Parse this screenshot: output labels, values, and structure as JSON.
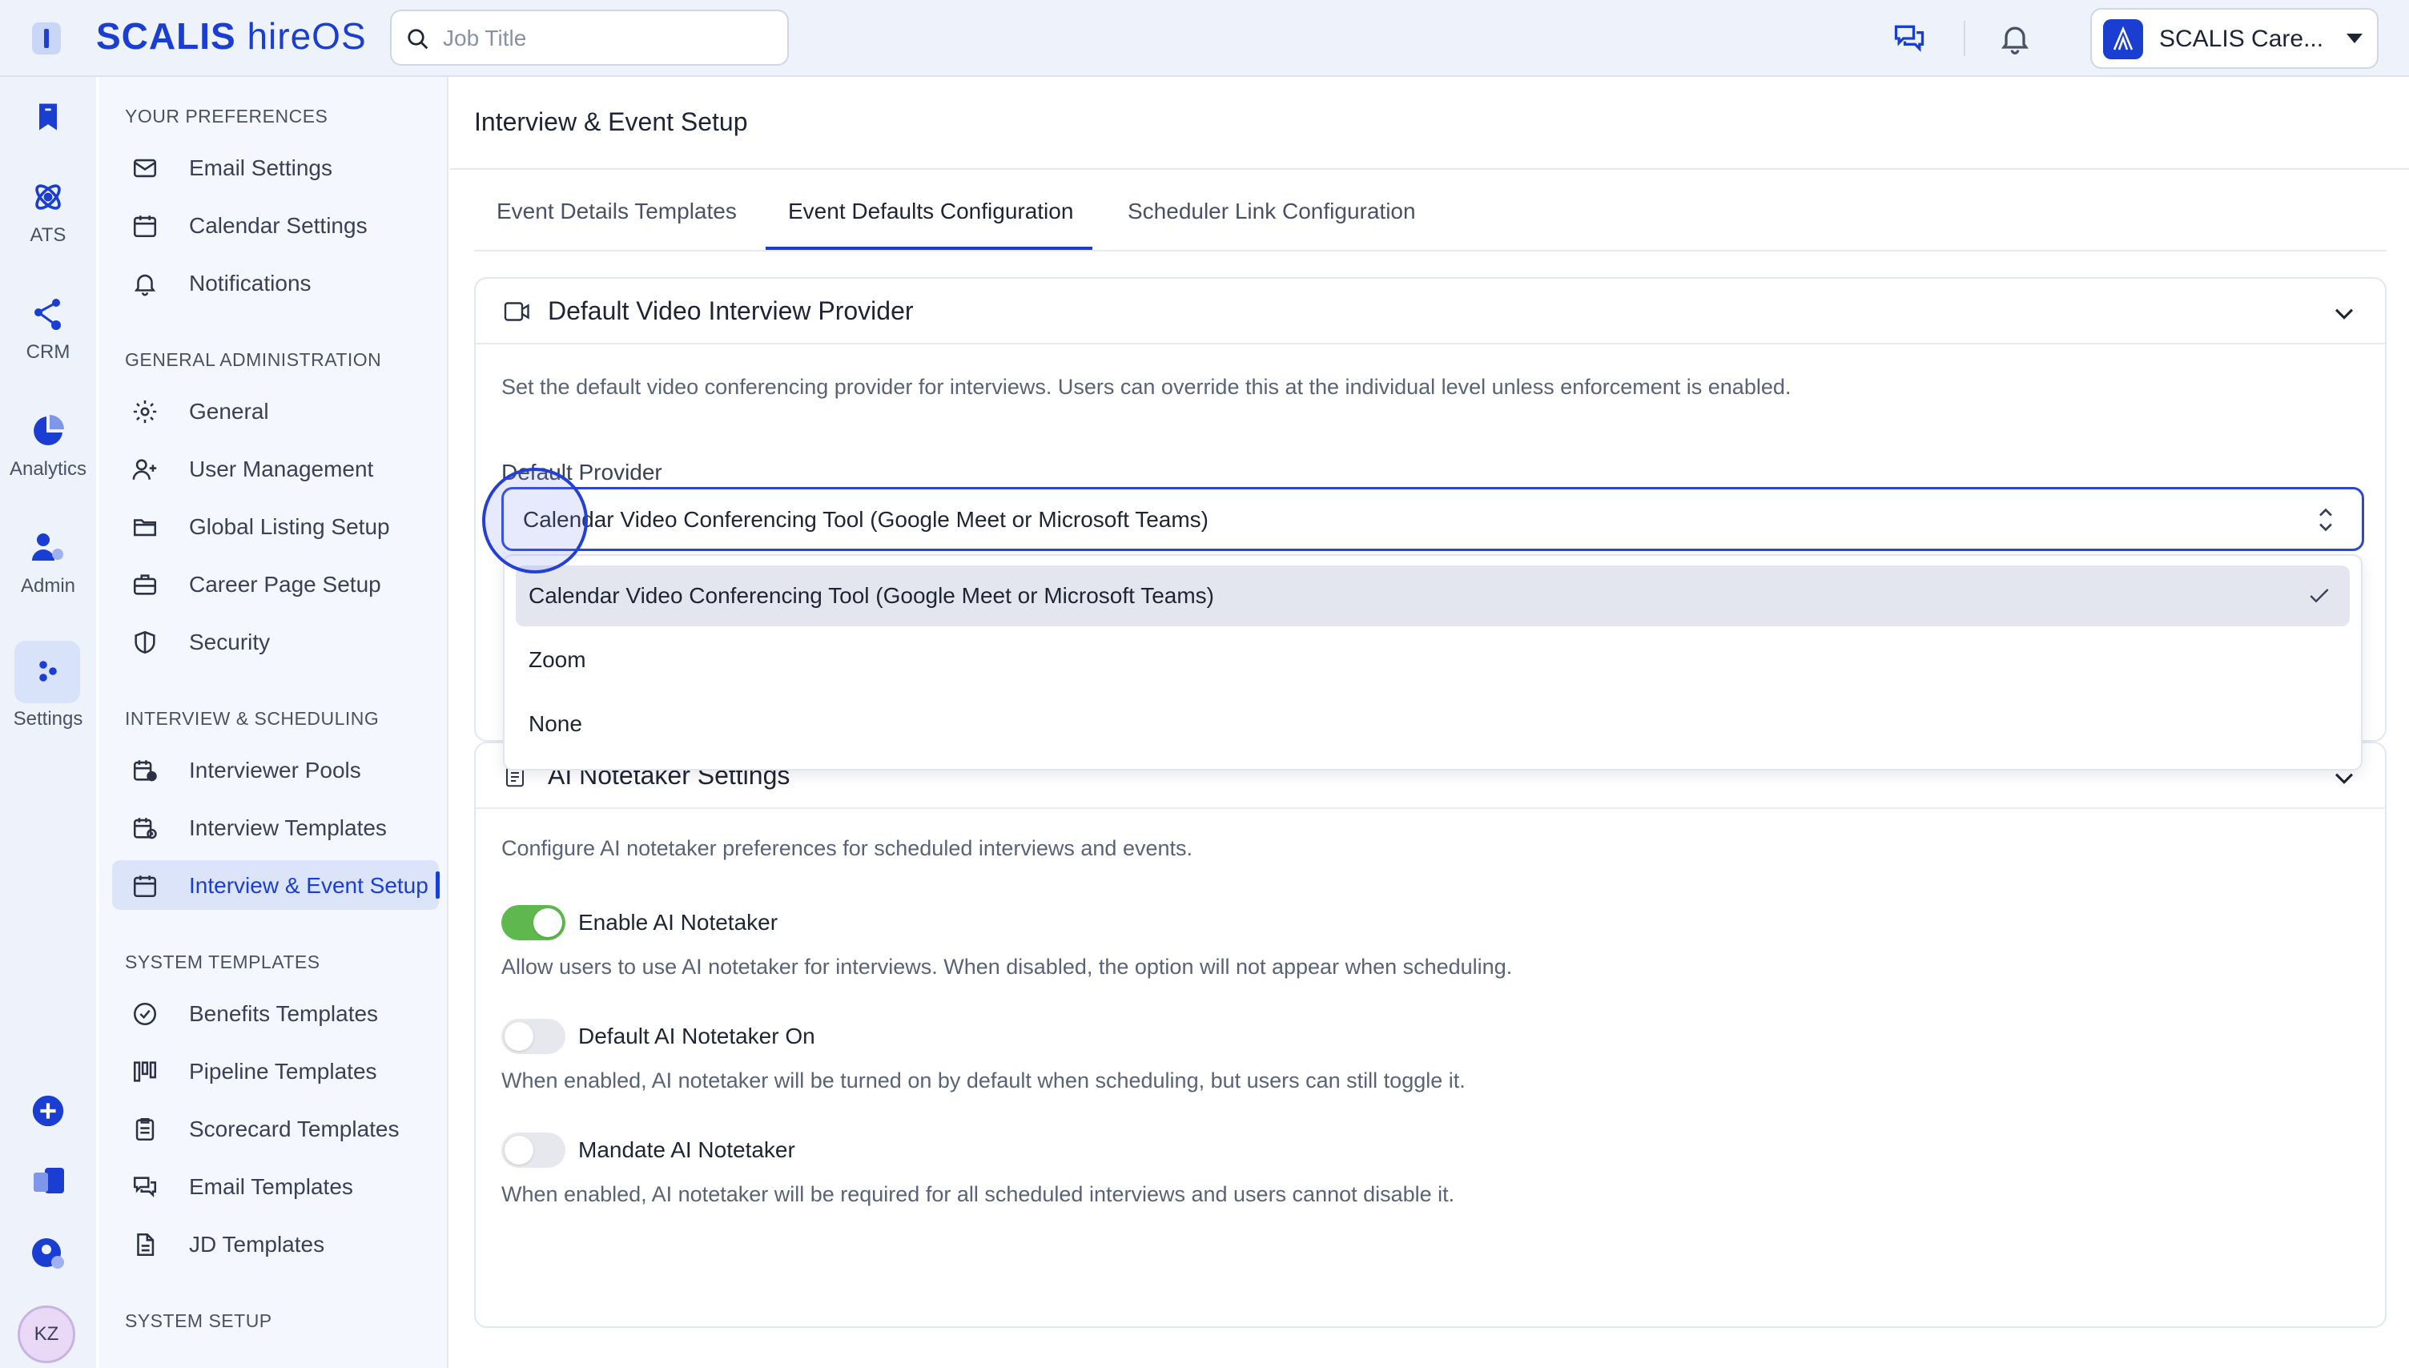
{
  "app": {
    "brand_bold": "SCALIS",
    "brand_light": "hireOS"
  },
  "search": {
    "placeholder": "Job Title"
  },
  "org": {
    "name": "SCALIS Care..."
  },
  "rail": {
    "items": [
      {
        "label": "ATS",
        "icon": "atom-icon"
      },
      {
        "label": "CRM",
        "icon": "network-icon"
      },
      {
        "label": "Analytics",
        "icon": "pie-chart-icon"
      },
      {
        "label": "Admin",
        "icon": "admin-user-icon"
      },
      {
        "label": "Settings",
        "icon": "settings-dots-icon"
      }
    ],
    "avatar_initials": "KZ"
  },
  "sidebar": {
    "sections": [
      {
        "label": "YOUR PREFERENCES",
        "items": [
          "Email Settings",
          "Calendar Settings",
          "Notifications"
        ]
      },
      {
        "label": "GENERAL ADMINISTRATION",
        "items": [
          "General",
          "User Management",
          "Global Listing Setup",
          "Career Page Setup",
          "Security"
        ]
      },
      {
        "label": "INTERVIEW & SCHEDULING",
        "items": [
          "Interviewer Pools",
          "Interview Templates",
          "Interview & Event Setup"
        ]
      },
      {
        "label": "SYSTEM TEMPLATES",
        "items": [
          "Benefits Templates",
          "Pipeline Templates",
          "Scorecard Templates",
          "Email Templates",
          "JD Templates"
        ]
      },
      {
        "label": "SYSTEM SETUP",
        "items": []
      }
    ],
    "active_item": "Interview & Event Setup"
  },
  "main": {
    "title": "Interview & Event Setup",
    "tabs": [
      {
        "label": "Event Details Templates"
      },
      {
        "label": "Event Defaults Configuration"
      },
      {
        "label": "Scheduler Link Configuration"
      }
    ],
    "active_tab": "Event Defaults Configuration",
    "video_card": {
      "title": "Default Video Interview Provider",
      "description": "Set the default video conferencing provider for interviews. Users can override this at the individual level unless enforcement is enabled.",
      "field_label": "Default Provider",
      "selected_value": "Calendar Video Conferencing Tool (Google Meet or Microsoft Teams)",
      "options": [
        "Calendar Video Conferencing Tool (Google Meet or Microsoft Teams)",
        "Zoom",
        "None"
      ]
    },
    "notetaker_card": {
      "title": "AI Notetaker Settings",
      "description": "Configure AI notetaker preferences for scheduled interviews and events.",
      "toggles": [
        {
          "label": "Enable AI Notetaker",
          "on": true,
          "description": "Allow users to use AI notetaker for interviews. When disabled, the option will not appear when scheduling."
        },
        {
          "label": "Default AI Notetaker On",
          "on": false,
          "description": "When enabled, AI notetaker will be turned on by default when scheduling, but users can still toggle it."
        },
        {
          "label": "Mandate AI Notetaker",
          "on": false,
          "description": "When enabled, AI notetaker will be required for all scheduled interviews and users cannot disable it."
        }
      ]
    }
  },
  "colors": {
    "accent": "#1a3ed1",
    "toggle_on": "#5fb84d",
    "sidebar_active_bg": "#dbe4f9"
  }
}
